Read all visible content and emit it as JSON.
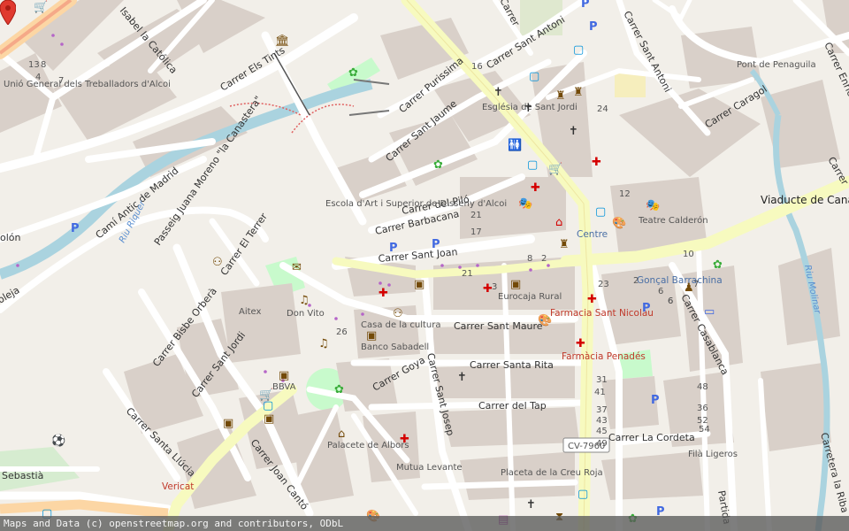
{
  "colors": {
    "background": "#f2efe9",
    "building": "#d9d0c9",
    "road": "#ffffff",
    "main_road": "#f7fabf",
    "trunk_road": "#fcd6a4",
    "river": "#aad3df",
    "park": "#c8facc",
    "marker": "#e03a2f"
  },
  "streets": {
    "isabel_catolica": "Isabel la Católica",
    "els_tints": "Carrer Els Tints",
    "sant_antoni_top": "Carrer Sant Antoni",
    "sant_antoni_right": "Carrer Sant Antoni",
    "purissima": "Carrer Purissima",
    "sant_jaume": "Carrer Sant Jaume",
    "canastera": "Passeig Juana Moreno \"la Canastera\"",
    "cami_madrid": "Camí Antic de Madrid",
    "carrer_pilo": "Carrer del Piló",
    "barbacana": "Carrer Barbacana",
    "sant_joan": "Carrer Sant Joan",
    "el_terrer": "Carrer El Terrer",
    "bisbe_orbera": "Carrer Bisbe Orberà",
    "sant_jordi": "Carrer Sant Jordi",
    "santa_llucia": "Carrer Santa Llúcia",
    "joan_canto": "Carrer Joan Cantó",
    "goya": "Carrer Goya",
    "sant_josep": "Carrer Sant Josep",
    "sant_maure": "Carrer Sant Maure",
    "santa_rita": "Carrer Santa Rita",
    "del_tap": "Carrer del Tap",
    "la_cordeta": "Carrer La Cordeta",
    "casablanca": "Carrer Casablanca",
    "caragol": "Carrer Caragol",
    "sebastia": "Sebastià",
    "partida": "Partida",
    "carretera_riba": "Carretera la Riba",
    "enric": "Carrer Enric",
    "olon": "olón",
    "oleja": "oleja",
    "carrer_top": "Carrer"
  },
  "places": {
    "esglesia": "Església de Sant Jordi",
    "escola": "Escola d'Art i Superior de Disseny d'Alcoi",
    "centre": "Centre",
    "viaducte": "Viaducte de Canalejas",
    "teatre": "Teatre Calderón",
    "pont": "Pont de Penaguila",
    "aitex": "Aitex",
    "don_vito": "Don Vito",
    "casa_cultura": "Casa de la cultura",
    "banco": "Banco Sabadell",
    "bbva": "BBVA",
    "eurocaja": "Eurocaja Rural",
    "farmacia_nicolau": "Farmacia Sant Nicolau",
    "farmacia_penades": "Farmàcia Penadés",
    "goncal": "Gonçal Barrachina",
    "palacete": "Palacete de Albors",
    "mutua": "Mutua Levante",
    "placeta": "Placeta de la Creu Roja",
    "fila": "Filà Ligeros",
    "vericat": "Vericat",
    "union": "Unió General dels Treballadors d'Alcoi",
    "riu_riquer": "Riu Riquer",
    "riu_molinar": "Riu Molinar",
    "cv_road": "CV-7960"
  },
  "house_numbers": [
    "13",
    "8",
    "4",
    "7",
    "16",
    "24",
    "12",
    "21",
    "8",
    "2",
    "17",
    "6",
    "10",
    "7",
    "23",
    "21",
    "2",
    "3",
    "2",
    "6",
    "16",
    "26",
    "48",
    "36",
    "52",
    "54",
    "41",
    "37",
    "43",
    "45",
    "49",
    "31",
    "6",
    "3",
    "3",
    "11"
  ],
  "attribution": "Maps and Data (c) openstreetmap.org and contributors, ODbL"
}
